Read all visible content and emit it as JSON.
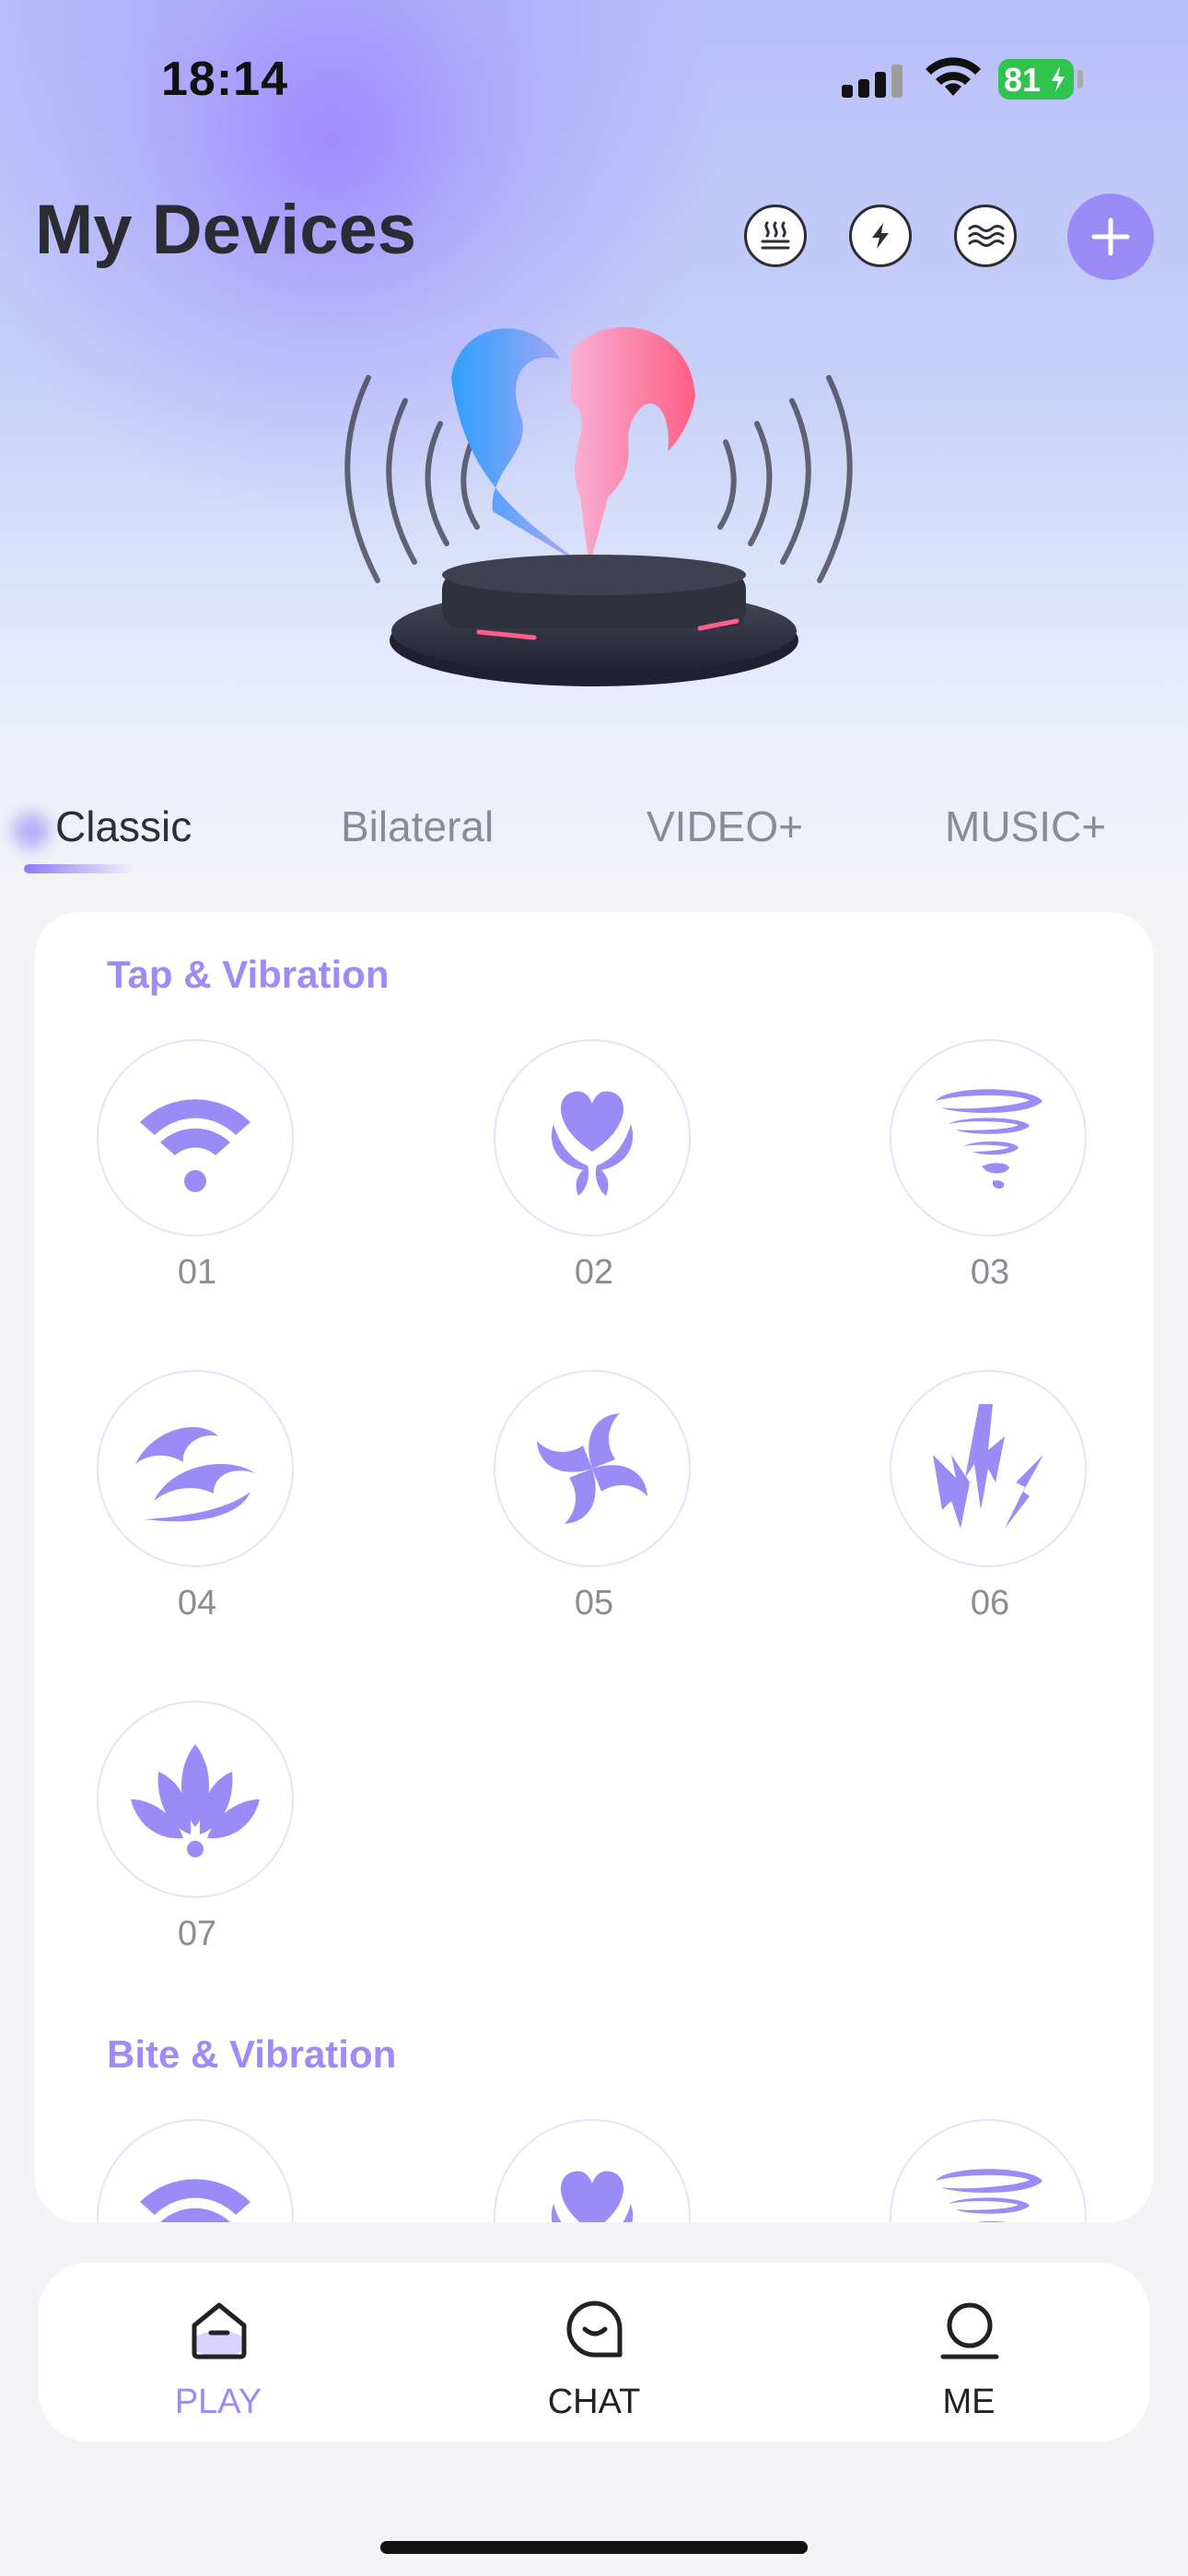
{
  "status_bar": {
    "time": "18:14",
    "battery": "81"
  },
  "header": {
    "title": "My Devices",
    "mode_icons": [
      "heat-icon",
      "lightning-icon",
      "water-waves-icon"
    ],
    "add_icon": "plus-icon"
  },
  "tabs": [
    {
      "label": "Classic",
      "active": true
    },
    {
      "label": "Bilateral",
      "active": false
    },
    {
      "label": "VIDEO+",
      "active": false
    },
    {
      "label": "MUSIC+",
      "active": false
    }
  ],
  "sections": [
    {
      "title": "Tap & Vibration",
      "patterns": [
        {
          "label": "01",
          "icon": "wifi-waves-icon"
        },
        {
          "label": "02",
          "icon": "heart-hands-icon"
        },
        {
          "label": "03",
          "icon": "tornado-icon"
        },
        {
          "label": "04",
          "icon": "wave-icon"
        },
        {
          "label": "05",
          "icon": "swirl-icon"
        },
        {
          "label": "06",
          "icon": "lightning-bolts-icon"
        },
        {
          "label": "07",
          "icon": "lotus-icon"
        }
      ]
    },
    {
      "title": "Bite & Vibration",
      "patterns": [
        {
          "label": "",
          "icon": "wifi-waves-icon"
        },
        {
          "label": "",
          "icon": "heart-hands-icon"
        },
        {
          "label": "",
          "icon": "tornado-icon"
        }
      ]
    }
  ],
  "bottom_nav": [
    {
      "label": "PLAY",
      "icon": "play-home-icon",
      "active": true
    },
    {
      "label": "CHAT",
      "icon": "chat-icon",
      "active": false
    },
    {
      "label": "ME",
      "icon": "profile-icon",
      "active": false
    }
  ],
  "colors": {
    "accent": "#9b8bf7",
    "tab_inactive": "#8b8b98",
    "title": "#2b2b33"
  }
}
